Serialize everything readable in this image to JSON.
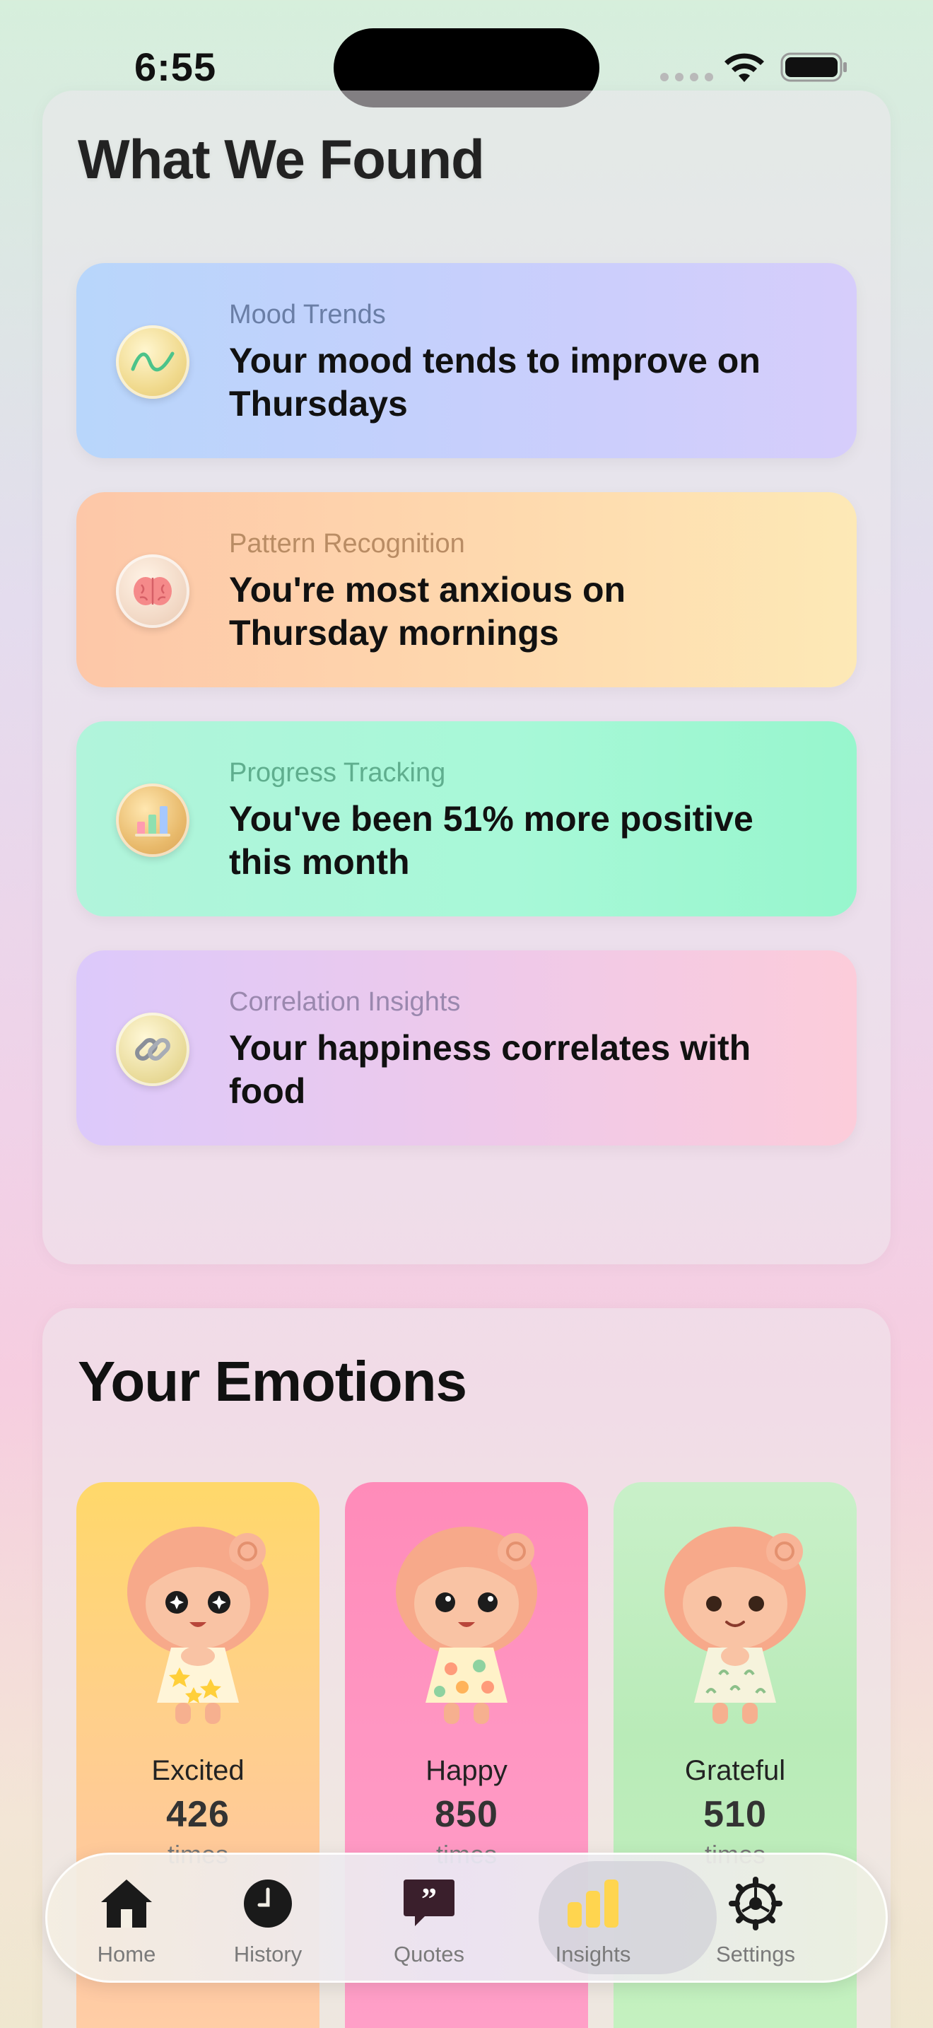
{
  "status_bar": {
    "time": "6:55"
  },
  "found": {
    "title": "What We Found",
    "insights": [
      {
        "category": "Mood Trends",
        "message": "Your mood tends to improve on Thursdays",
        "icon": "trend-line-icon"
      },
      {
        "category": "Pattern Recognition",
        "message": "You're most anxious on Thursday mornings",
        "icon": "brain-icon"
      },
      {
        "category": "Progress Tracking",
        "message": "You've been 51% more positive this month",
        "icon": "bar-chart-icon"
      },
      {
        "category": "Correlation Insights",
        "message": "Your happiness correlates with food",
        "icon": "chain-link-icon"
      }
    ]
  },
  "emotions": {
    "title": "Your Emotions",
    "items": [
      {
        "name": "Excited",
        "count": "426",
        "unit": "times"
      },
      {
        "name": "Happy",
        "count": "850",
        "unit": "times"
      },
      {
        "name": "Grateful",
        "count": "510",
        "unit": "times"
      }
    ]
  },
  "tabbar": {
    "active": "Insights",
    "tabs": [
      {
        "label": "Home",
        "icon": "house-icon"
      },
      {
        "label": "History",
        "icon": "clock-icon"
      },
      {
        "label": "Quotes",
        "icon": "quote-bubble-icon"
      },
      {
        "label": "Insights",
        "icon": "bar-chart-icon"
      },
      {
        "label": "Settings",
        "icon": "gear-icon"
      }
    ]
  },
  "colors": {
    "active_tab_icon": "#ffd54f",
    "inactive_tab_icon": "#1a1a1a",
    "quotes_icon": "#3a1f2c"
  }
}
